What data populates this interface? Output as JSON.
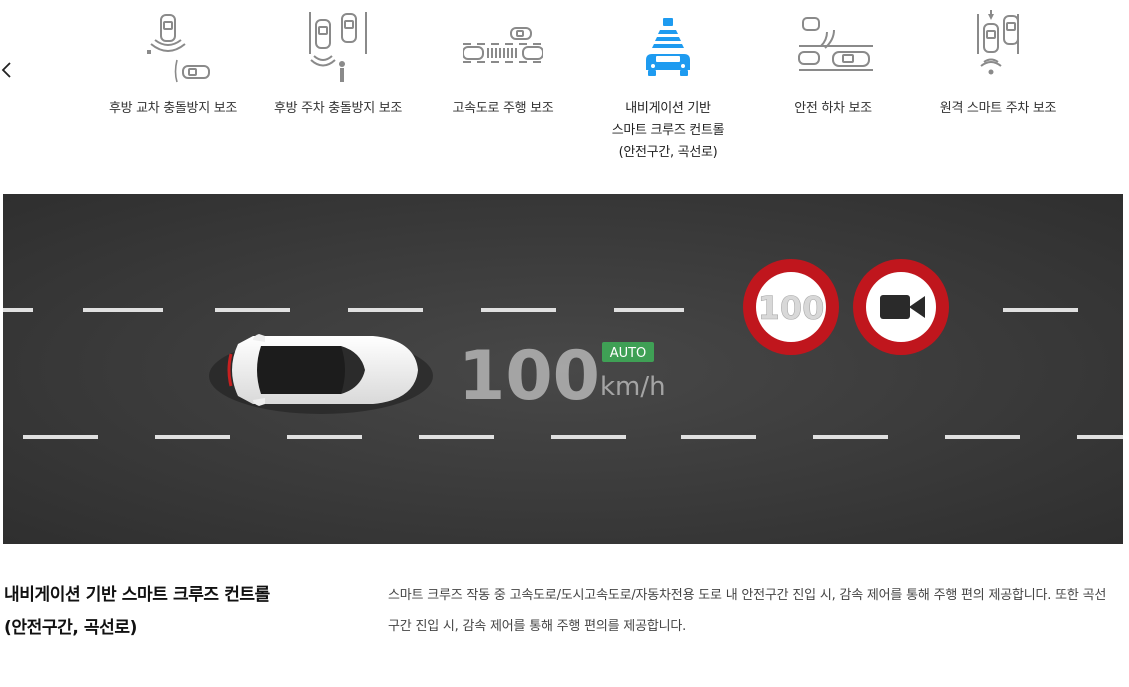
{
  "tabs": [
    {
      "label": "후방 교차 충돌방지 보조",
      "icon": "rear-cross-traffic-icon",
      "active": false
    },
    {
      "label": "후방 주차 충돌방지 보조",
      "icon": "rear-parking-collision-icon",
      "active": false
    },
    {
      "label": "고속도로 주행 보조",
      "icon": "highway-driving-assist-icon",
      "active": false
    },
    {
      "label": "내비게이션 기반\n스마트 크루즈 컨트롤\n(안전구간, 곡선로)",
      "icon": "nav-smart-cruise-icon",
      "active": true
    },
    {
      "label": "안전 하차 보조",
      "icon": "safe-exit-assist-icon",
      "active": false
    },
    {
      "label": "원격 스마트 주차 보조",
      "icon": "remote-smart-parking-icon",
      "active": false
    }
  ],
  "colors": {
    "accent": "#1e9bf0",
    "icon_gray": "#8a8a8a",
    "road": "#3b3b3b",
    "sign_red": "#c0161d",
    "auto_badge": "#3fa055"
  },
  "illustration": {
    "speed": "100",
    "mode_badge": "AUTO",
    "unit": "km/h",
    "speed_sign": "100",
    "camera_sign_icon": "speed-camera-icon"
  },
  "feature": {
    "title": "내비게이션 기반 스마트 크루즈 컨트롤\n(안전구간, 곡선로)",
    "description": "스마트 크루즈 작동 중 고속도로/도시고속도로/자동차전용 도로 내 안전구간 진입 시, 감속 제어를 통해 주행 편의 제공합니다. 또한 곡선 구간 진입 시, 감속 제어를 통해 주행 편의를 제공합니다."
  }
}
